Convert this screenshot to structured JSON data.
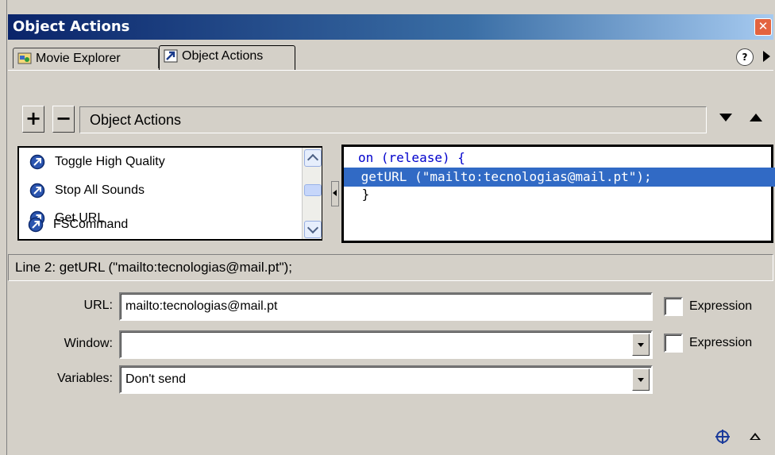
{
  "window": {
    "title": "Object Actions",
    "close_label": "✕",
    "colors": {
      "title_bar": "#0a246a",
      "selection": "#316ac5",
      "close": "#e3633f",
      "keyword": "#0000cc"
    }
  },
  "tabs": [
    {
      "label": "Movie Explorer",
      "icon": "movie-explorer-icon"
    },
    {
      "label": "Object Actions",
      "icon": "object-actions-icon"
    }
  ],
  "help_label": "?",
  "toolbar": {
    "add_label": "+",
    "remove_label": "−",
    "section_title": "Object Actions"
  },
  "action_list": {
    "items": [
      {
        "label": "Toggle High Quality",
        "icon": "action-icon"
      },
      {
        "label": "Stop All Sounds",
        "icon": "action-icon"
      },
      {
        "label": "Get URL",
        "icon": "action-icon"
      },
      {
        "label": "FSCommand",
        "icon": "action-icon"
      }
    ]
  },
  "code": {
    "lines": [
      {
        "keyword": "on",
        "rest": " (release) {"
      },
      {
        "text": " getURL (\"mailto:tecnologias@mail.pt\");"
      },
      {
        "text": " }"
      }
    ],
    "selected_line": 2
  },
  "status_line": "Line 2: getURL (\"mailto:tecnologias@mail.pt\");",
  "form": {
    "url": {
      "label": "URL:",
      "value": "mailto:tecnologias@mail.pt",
      "expression_label": "Expression",
      "expression_checked": false
    },
    "window": {
      "label": "Window:",
      "value": "",
      "expression_label": "Expression",
      "expression_checked": false
    },
    "variables": {
      "label": "Variables:",
      "value": "Don't send"
    }
  }
}
